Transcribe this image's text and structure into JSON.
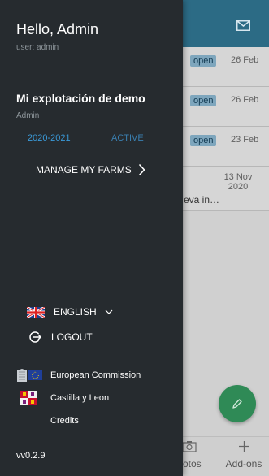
{
  "drawer": {
    "greeting": "Hello, Admin",
    "user_line": "user: admin",
    "farm_name": "Mi explotación de demo",
    "farm_role": "Admin",
    "season": "2020-2021",
    "season_status": "ACTIVE",
    "manage_farms": "MANAGE MY FARMS",
    "language": "ENGLISH",
    "logout": "LOGOUT",
    "org_ec": "European Commission",
    "org_cyl": "Castilla y Leon",
    "credits": "Credits",
    "version": "vv0.2.9"
  },
  "background": {
    "header_icon": "mail-icon",
    "rows": [
      {
        "badge": "open",
        "date": "26 Feb"
      },
      {
        "badge": "open",
        "date": "26 Feb"
      },
      {
        "badge": "open",
        "date": "23 Feb"
      }
    ],
    "last_row": {
      "snippet": "eva in…",
      "date": "13 Nov 2020"
    },
    "bottom_nav": {
      "photos": "hotos",
      "addons": "Add-ons"
    },
    "fab_icon": "pencil-icon"
  },
  "colors": {
    "drawer_bg": "#262b2f",
    "header": "#2c6b85",
    "season": "#3a9ad9",
    "fab": "#2f8a56"
  }
}
